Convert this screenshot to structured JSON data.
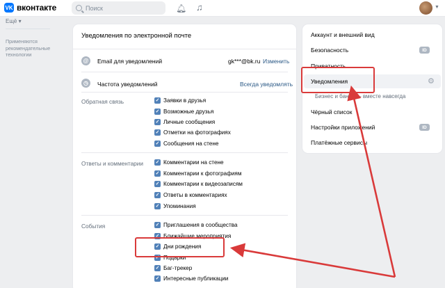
{
  "header": {
    "logo_mark": "VK",
    "logo_text": "вконтакте",
    "search_placeholder": "Поиск",
    "icons": [
      "vk-logo-icon",
      "search-icon",
      "bell-icon",
      "music-icon",
      "avatar",
      "chevron-down-icon"
    ]
  },
  "left_nav": {
    "more_label": "Ещё",
    "applied_note": "Применяются рекомендательные технологии"
  },
  "main": {
    "title": "Уведомления по электронной почте",
    "email_row": {
      "label": "Email для уведомлений",
      "value": "gk***@bk.ru",
      "action": "Изменить"
    },
    "frequency_row": {
      "label": "Частота уведомлений",
      "action": "Всегда уведомлять"
    },
    "groups": [
      {
        "label": "Обратная связь",
        "items": [
          "Заявки в друзья",
          "Возможные друзья",
          "Личные сообщения",
          "Отметки на фотографиях",
          "Сообщения на стене"
        ]
      },
      {
        "label": "Ответы и комментарии",
        "items": [
          "Комментарии на стене",
          "Комментарии к фотографиям",
          "Комментарии к видеозаписям",
          "Ответы в комментариях",
          "Упоминания"
        ]
      },
      {
        "label": "События",
        "items": [
          "Приглашения в сообщества",
          "Ближайшие мероприятия",
          "Дни рождения",
          "Подарки",
          "Баг-трекер",
          "Интересные публикации"
        ]
      }
    ],
    "checked": true
  },
  "side_menu": {
    "items": [
      {
        "label": "Аккаунт и внешний вид"
      },
      {
        "label": "Безопасность",
        "badge": "ID"
      },
      {
        "label": "Приватность"
      },
      {
        "label": "Уведомления",
        "active": true
      },
      {
        "label": "Бизнес и банки — вместе навсегда",
        "sub": true
      },
      {
        "label": "Чёрный список"
      },
      {
        "label": "Настройки приложений",
        "badge": "ID"
      },
      {
        "label": "Платёжные сервисы"
      }
    ]
  },
  "colors": {
    "accent": "#0077ff",
    "checkbox": "#5181b8",
    "link": "#2a5885",
    "annotation_red": "#d93a3a"
  }
}
